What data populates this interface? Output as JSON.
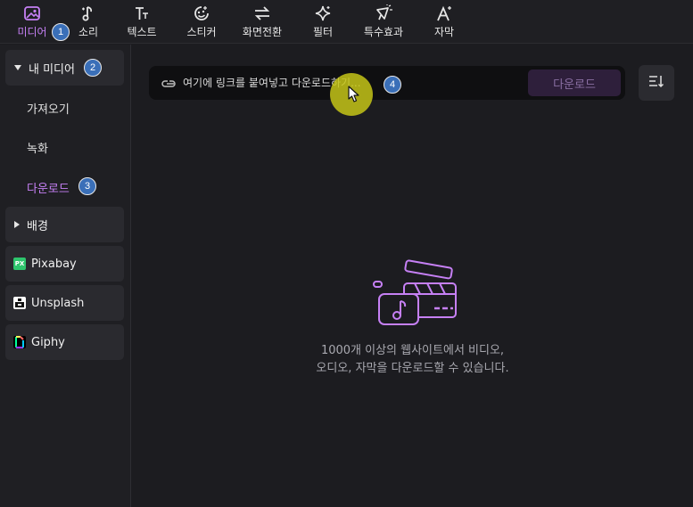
{
  "toolbar": {
    "items": [
      {
        "label": "미디어",
        "icon": "media-icon",
        "active": true
      },
      {
        "label": "소리",
        "icon": "music-note-icon"
      },
      {
        "label": "텍스트",
        "icon": "text-icon"
      },
      {
        "label": "스티커",
        "icon": "sticker-icon"
      },
      {
        "label": "화면전환",
        "icon": "transition-icon"
      },
      {
        "label": "필터",
        "icon": "filter-sparkle-icon"
      },
      {
        "label": "특수효과",
        "icon": "effects-icon"
      },
      {
        "label": "자막",
        "icon": "caption-icon"
      }
    ]
  },
  "badges": {
    "b1": "1",
    "b2": "2",
    "b3": "3",
    "b4": "4"
  },
  "sidebar": {
    "my_media": "내 미디어",
    "import": "가져오기",
    "record": "녹화",
    "download": "다운로드",
    "background": "배경",
    "pixabay": "Pixabay",
    "pixabay_mark": "PX",
    "unsplash": "Unsplash",
    "giphy": "Giphy"
  },
  "main": {
    "url_placeholder": "여기에 링크를 붙여넣고 다운로드하기...",
    "download_button": "다운로드",
    "empty_line1": "1000개 이상의 웹사이트에서 비디오,",
    "empty_line2": "오디오, 자막을 다운로드할 수 있습니다."
  },
  "colors": {
    "accent": "#c680f5",
    "badge": "#3a6fb8",
    "cursor_highlight": "#c4c418"
  }
}
